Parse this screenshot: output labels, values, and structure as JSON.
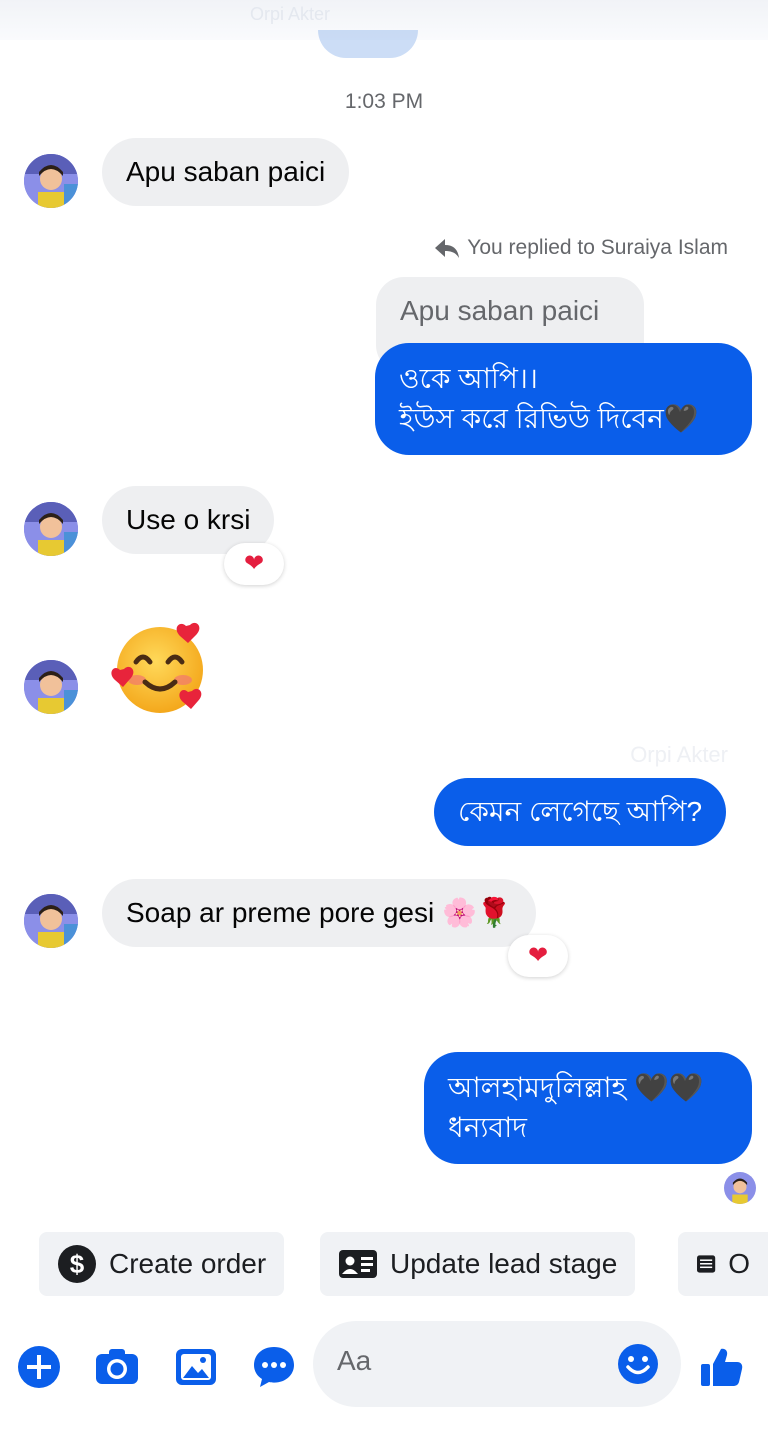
{
  "header": {
    "ghost_text": "Orpi Akter"
  },
  "conversation": {
    "timestamp": "1:03 PM",
    "messages": [
      {
        "text": "Apu saban paici"
      },
      {
        "reply_note": "You replied to Suraiya Islam",
        "quoted": "Apu saban paici",
        "line1": "ওকে আপি।।",
        "line2": "ইউস করে রিভিউ দিবেন🖤"
      },
      {
        "text": "Use o krsi",
        "reaction": "❤"
      },
      {
        "emoji": "smiling-face-with-hearts"
      },
      {
        "text": "কেমন লেগেছে আপি?"
      },
      {
        "text": "Soap ar preme pore gesi 🌸🌹",
        "reaction": "❤"
      },
      {
        "line1": "আলহামদুলিল্লাহ 🖤🖤",
        "line2": "ধন্যবাদ"
      }
    ],
    "watermark": "Orpi Akter"
  },
  "quick_actions": [
    {
      "label": "Create order",
      "icon": "dollar-icon"
    },
    {
      "label": "Update lead stage",
      "icon": "contact-card-icon"
    },
    {
      "label": "O",
      "icon": "list-icon"
    }
  ],
  "composer": {
    "placeholder": "Aa",
    "icons": [
      "plus-icon",
      "camera-icon",
      "gallery-icon",
      "more-icon",
      "emoji-icon",
      "thumbs-up-icon"
    ]
  },
  "colors": {
    "accent": "#0a5eea",
    "incoming": "#eeeff1",
    "reaction": "#e41e3f"
  }
}
